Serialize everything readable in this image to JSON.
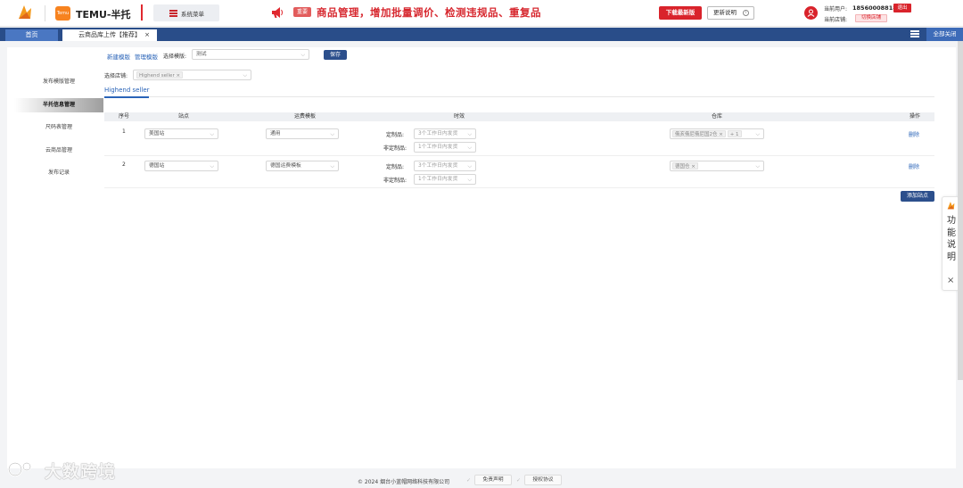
{
  "header": {
    "brand": "TEMU-半托",
    "temu_badge": "Temu",
    "system_menu": "系统菜单",
    "news_badge": "重要",
    "headline": "商品管理，增加批量调价、检测违规品、重复品",
    "download_btn": "下载最新版",
    "update_btn": "更新说明",
    "info_glyph": "i",
    "user_label": "当前用户:",
    "user_value": "18560008818",
    "exit_btn": "退出",
    "store_label": "当前店铺:",
    "switch_store_btn": "切换店铺",
    "brand_color": "#d9232b"
  },
  "tabs": {
    "home": "首页",
    "active": "云商品库上传【推荐】",
    "close_glyph": "×",
    "close_all": "全部关闭"
  },
  "sidebar": {
    "items": [
      {
        "label": "发布模版管理",
        "active": false
      },
      {
        "label": "半托信息管理",
        "active": true
      },
      {
        "label": "尺码表管理",
        "active": false
      },
      {
        "label": "云商品管理",
        "active": false
      },
      {
        "label": "发布记录",
        "active": false
      }
    ]
  },
  "toolbar": {
    "new_template": "新建模版",
    "manage_template": "管理模版",
    "select_template_label": "选择模版:",
    "template_value": "测试",
    "save_btn": "保存",
    "select_store_label": "选择店铺:",
    "store_tag": "Highend seller"
  },
  "subtab": "Highend seller",
  "table": {
    "headers": [
      "序号",
      "站点",
      "运费模板",
      "时效",
      "仓库",
      "操作"
    ],
    "custom_label": "定制品:",
    "noncustom_label": "非定制品:",
    "rows": [
      {
        "index": "1",
        "site": "美国站",
        "shipping": "通用",
        "custom_time": "3个工作日内发货",
        "noncustom_time": "1个工作日内发货",
        "warehouse_tag": "俄亥俄尼俄尼国2仓",
        "warehouse_more": "+ 1",
        "action": "删除"
      },
      {
        "index": "2",
        "site": "德国站",
        "shipping": "德国运费模板",
        "custom_time": "3个工作日内发货",
        "noncustom_time": "1个工作日内发货",
        "warehouse_tag": "德国仓",
        "warehouse_more": "",
        "action": "删除"
      }
    ],
    "add_site_btn": "添加站点"
  },
  "footer": {
    "copyright": "© 2024 烟台小蓝帽网络科技有限公司",
    "disclaimer": "免责声明",
    "license": "授权协议"
  },
  "watermark": "大数跨境",
  "float_help": {
    "text": "功能说明",
    "close_glyph": "×"
  }
}
